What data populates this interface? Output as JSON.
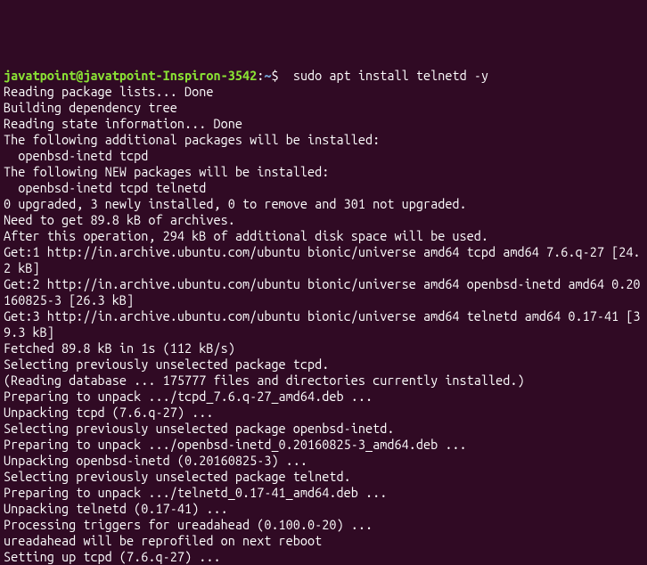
{
  "prompt": {
    "user_host": "javatpoint@javatpoint-Inspiron-3542",
    "colon": ":",
    "path": "~",
    "dollar": "$"
  },
  "command": "  sudo apt install telnetd -y",
  "output": "Reading package lists... Done\nBuilding dependency tree\nReading state information... Done\nThe following additional packages will be installed:\n  openbsd-inetd tcpd\nThe following NEW packages will be installed:\n  openbsd-inetd tcpd telnetd\n0 upgraded, 3 newly installed, 0 to remove and 301 not upgraded.\nNeed to get 89.8 kB of archives.\nAfter this operation, 294 kB of additional disk space will be used.\nGet:1 http://in.archive.ubuntu.com/ubuntu bionic/universe amd64 tcpd amd64 7.6.q-27 [24.2 kB]\nGet:2 http://in.archive.ubuntu.com/ubuntu bionic/universe amd64 openbsd-inetd amd64 0.20160825-3 [26.3 kB]\nGet:3 http://in.archive.ubuntu.com/ubuntu bionic/universe amd64 telnetd amd64 0.17-41 [39.3 kB]\nFetched 89.8 kB in 1s (112 kB/s)\nSelecting previously unselected package tcpd.\n(Reading database ... 175777 files and directories currently installed.)\nPreparing to unpack .../tcpd_7.6.q-27_amd64.deb ...\nUnpacking tcpd (7.6.q-27) ...\nSelecting previously unselected package openbsd-inetd.\nPreparing to unpack .../openbsd-inetd_0.20160825-3_amd64.deb ...\nUnpacking openbsd-inetd (0.20160825-3) ...\nSelecting previously unselected package telnetd.\nPreparing to unpack .../telnetd_0.17-41_amd64.deb ...\nUnpacking telnetd (0.17-41) ...\nProcessing triggers for ureadahead (0.100.0-20) ...\nureadahead will be reprofiled on next reboot\nSetting up tcpd (7.6.q-27) ..."
}
